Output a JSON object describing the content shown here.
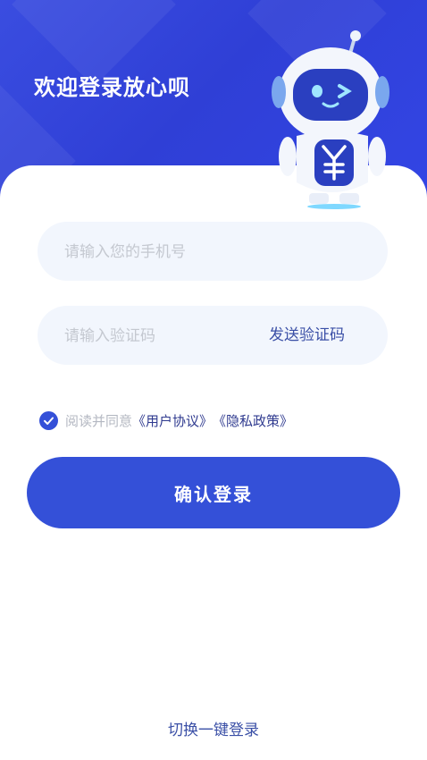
{
  "header": {
    "title": "欢迎登录放心呗"
  },
  "robot": {
    "chest_symbol": "¥"
  },
  "form": {
    "phone": {
      "placeholder": "请输入您的手机号",
      "value": ""
    },
    "code": {
      "placeholder": "请输入验证码",
      "value": "",
      "send_label": "发送验证码"
    }
  },
  "agreement": {
    "checked": true,
    "prefix": "阅读并同意",
    "user_agreement": "《用户协议》",
    "privacy_policy": "《隐私政策》"
  },
  "buttons": {
    "confirm_label": "确认登录",
    "switch_label": "切换一键登录"
  },
  "colors": {
    "primary": "#3450d8",
    "header": "#2f3fd6",
    "input_bg": "#f2f6fd",
    "link": "#2f3a8f"
  },
  "icons": {
    "check": "check-icon",
    "robot": "robot-mascot-icon"
  }
}
